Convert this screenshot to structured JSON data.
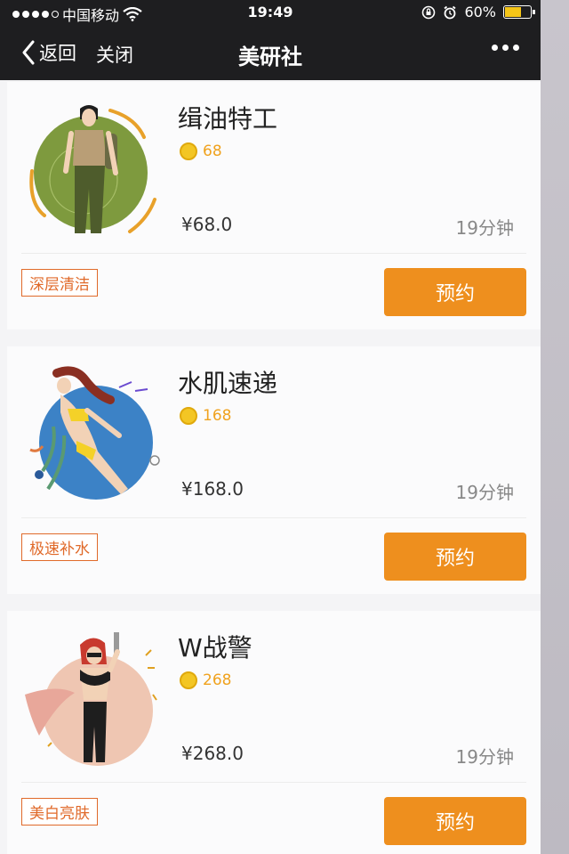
{
  "status_bar": {
    "carrier": "中国移动",
    "time": "19:49",
    "battery": "60%"
  },
  "nav": {
    "back_label": "返回",
    "close_label": "关闭",
    "title": "美研社"
  },
  "colors": {
    "accent": "#ee8f1e",
    "coin": "#f3c624",
    "tag": "#e06a2a",
    "nav_bg": "#1e1e20"
  },
  "services": [
    {
      "name": "缉油特工",
      "points": "68",
      "price": "¥68.0",
      "duration": "19分钟",
      "tag": "深层清洁",
      "button": "预约",
      "image": "woman-with-backpack-illustration"
    },
    {
      "name": "水肌速递",
      "points": "168",
      "price": "¥168.0",
      "duration": "19分钟",
      "tag": "极速补水",
      "button": "预约",
      "image": "swimmer-illustration"
    },
    {
      "name": "W战警",
      "points": "268",
      "price": "¥268.0",
      "duration": "19分钟",
      "tag": "美白亮肤",
      "button": "预约",
      "image": "agent-woman-illustration"
    }
  ]
}
